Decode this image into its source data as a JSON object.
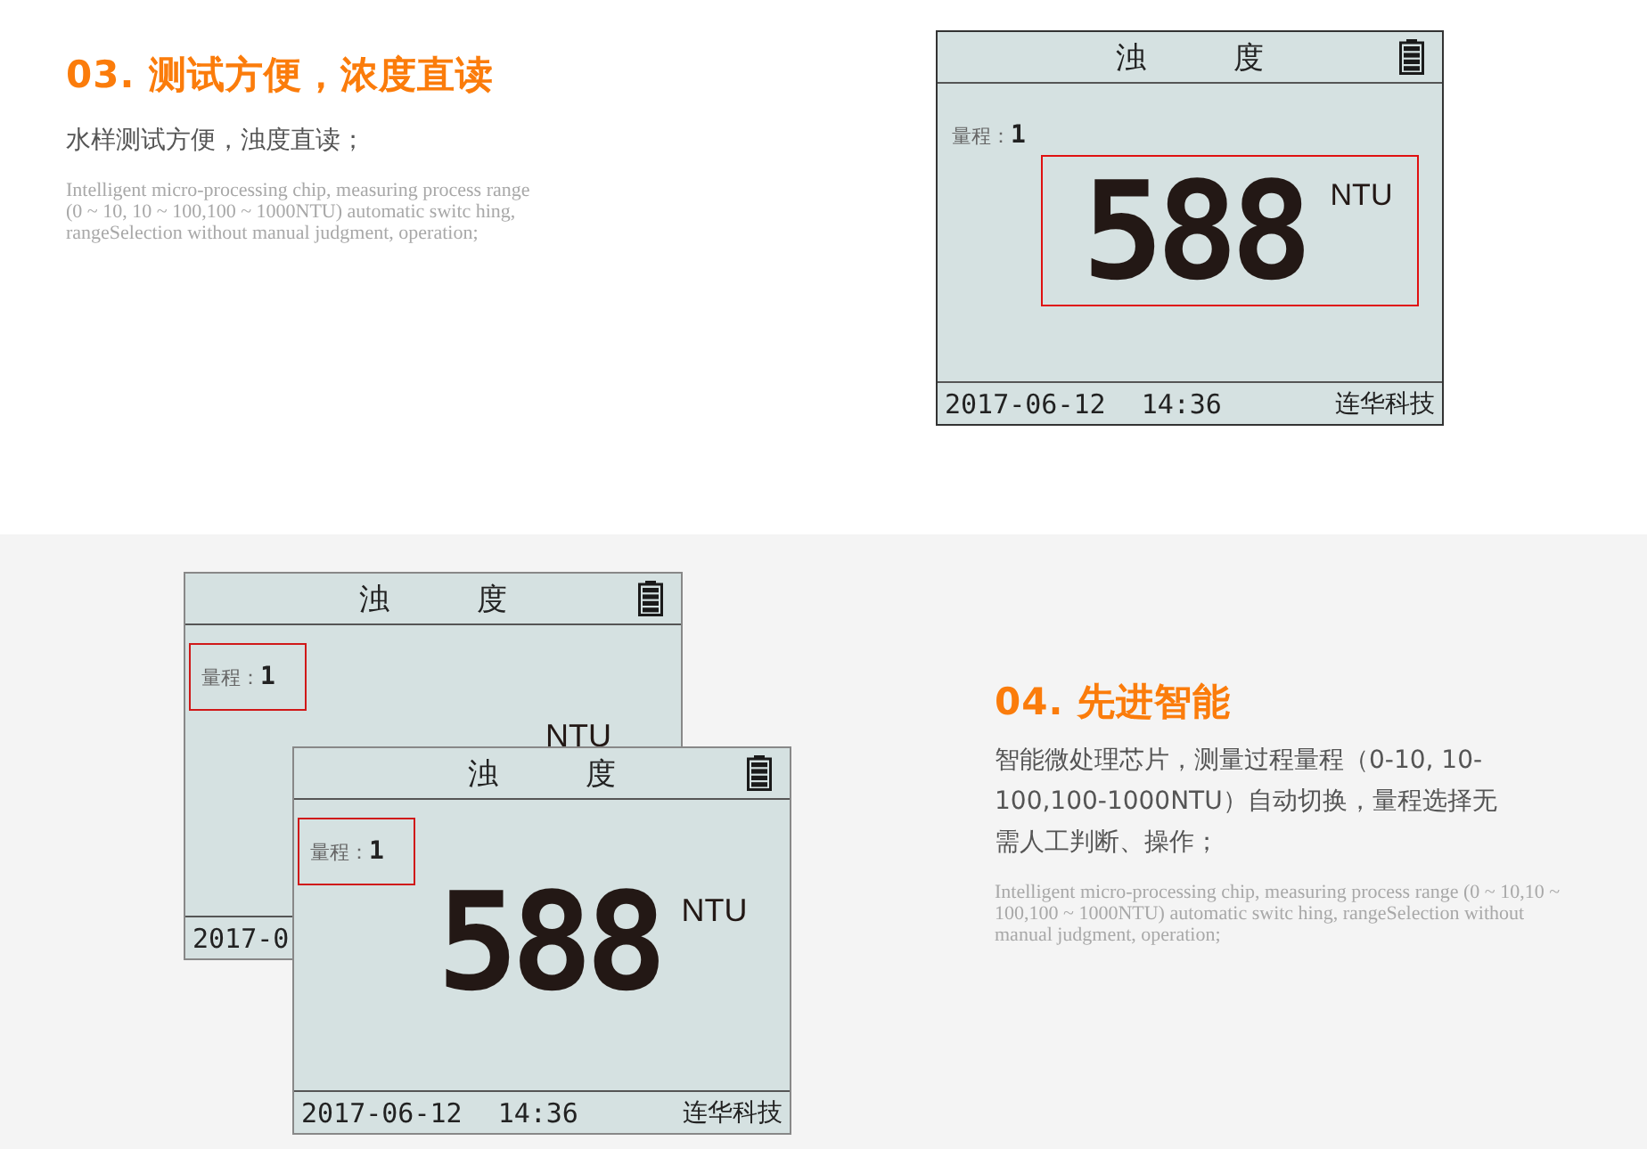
{
  "section_03": {
    "heading": "03. 测试方便，浓度直读",
    "subtitle": "水样测试方便，浊度直读；",
    "english": "Intelligent micro-processing chip, measuring process range (0 ~ 10, 10 ~ 100,100 ~ 1000NTU) automatic switc hing, rangeSelection without manual judgment, operation;",
    "display": {
      "title": "浊 度",
      "range_label": "量程：",
      "range_value": "1",
      "reading": "588",
      "unit": "NTU",
      "date": "2017-06-12",
      "time": "14:36",
      "brand": "连华科技",
      "range_framed": false,
      "reading_framed": true
    }
  },
  "section_04": {
    "heading": "04. 先进智能",
    "subtitle": "智能微处理芯片，测量过程量程（0-10, 10-100,100-1000NTU）自动切换，量程选择无需人工判断、操作；",
    "english": "Intelligent micro-processing chip, measuring process range (0 ~ 10,10 ~ 100,100 ~ 1000NTU) automatic switc hing, rangeSelection without manual judgment, operation;",
    "displays": [
      {
        "title": "浊 度",
        "range_label": "量程：",
        "range_value": "1",
        "unit": "NTU",
        "date": "2017-0",
        "range_framed": true,
        "reading_framed": false
      },
      {
        "title": "浊 度",
        "range_label": "量程：",
        "range_value": "1",
        "reading": "588",
        "unit": "NTU",
        "date": "2017-06-12",
        "time": "14:36",
        "brand": "连华科技",
        "range_framed": true,
        "reading_framed": false
      }
    ]
  }
}
